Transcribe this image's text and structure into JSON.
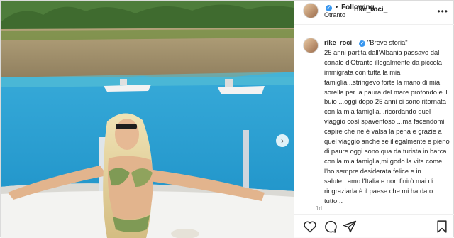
{
  "post": {
    "username": "rike_roci_",
    "follow_separator": "•",
    "follow_label": "Following",
    "location": "Otranto",
    "caption_title": "\"Breve storia\"",
    "caption_body": "25 anni partita dall'Albania passavo dal canale d'Otranto illegalmente da piccola immigrata con tutta la mia famiglia...stringevo forte la mano di mia sorella per la paura del mare profondo e il buio ...oggi dopo 25 anni ci sono ritornata con la mia famiglia...ricordando quel viaggio così spaventoso ...ma facendomi capire che ne è valsa la pena e grazie a quel viaggio anche se illegalmente e pieno di paure oggi sono qua da turista in barca con la mia famiglia,mi godo la vita come l'ho sempre desiderata felice e in salute...amo l'Italia e non finirò mai di ringraziarla è il paese che mi ha dato tutto...",
    "time_ago": "1d"
  },
  "icons": {
    "verified": "verified-badge-icon",
    "more": "more-options-icon",
    "like": "heart-icon",
    "comment": "comment-icon",
    "share": "share-icon",
    "save": "bookmark-icon",
    "next": "chevron-right-icon"
  },
  "colors": {
    "verified_blue": "#3897f0",
    "text": "#262626",
    "secondary": "#8e8e8e",
    "sea": "#2a9fd6"
  }
}
